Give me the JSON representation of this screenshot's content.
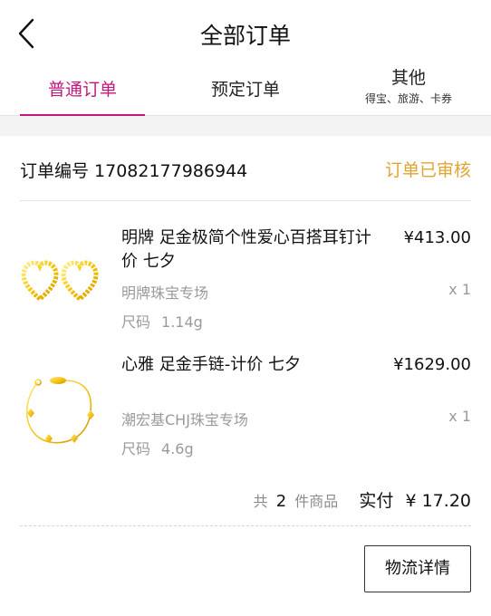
{
  "header": {
    "title": "全部订单"
  },
  "tabs": [
    {
      "label": "普通订单"
    },
    {
      "label": "预定订单"
    },
    {
      "label": "其他",
      "sublabel": "得宝、旅游、卡券"
    }
  ],
  "colors": {
    "accent": "#c2187a",
    "status": "#e0a431",
    "muted": "#9a9a9a"
  },
  "order": {
    "number_label": "订单编号",
    "number": "17082177986944",
    "status": "订单已审核",
    "items": [
      {
        "name": "明牌 足金极简个性爱心百搭耳钉计价 七夕",
        "price": "¥413.00",
        "shop": "明牌珠宝专场",
        "quantity": "x 1",
        "spec_label": "尺码",
        "spec_value": "1.14g",
        "thumb_icon": "heart-earrings-icon"
      },
      {
        "name": "心雅 足金手链-计价 七夕",
        "price": "¥1629.00",
        "shop": "潮宏基CHJ珠宝专场",
        "quantity": "x 1",
        "spec_label": "尺码",
        "spec_value": "4.6g",
        "thumb_icon": "bracelet-icon"
      }
    ],
    "summary": {
      "prefix": "共",
      "count": "2",
      "suffix": "件商品",
      "paid_label": "实付",
      "paid_amount": "¥ 17.20"
    },
    "logistics_button": "物流详情"
  }
}
